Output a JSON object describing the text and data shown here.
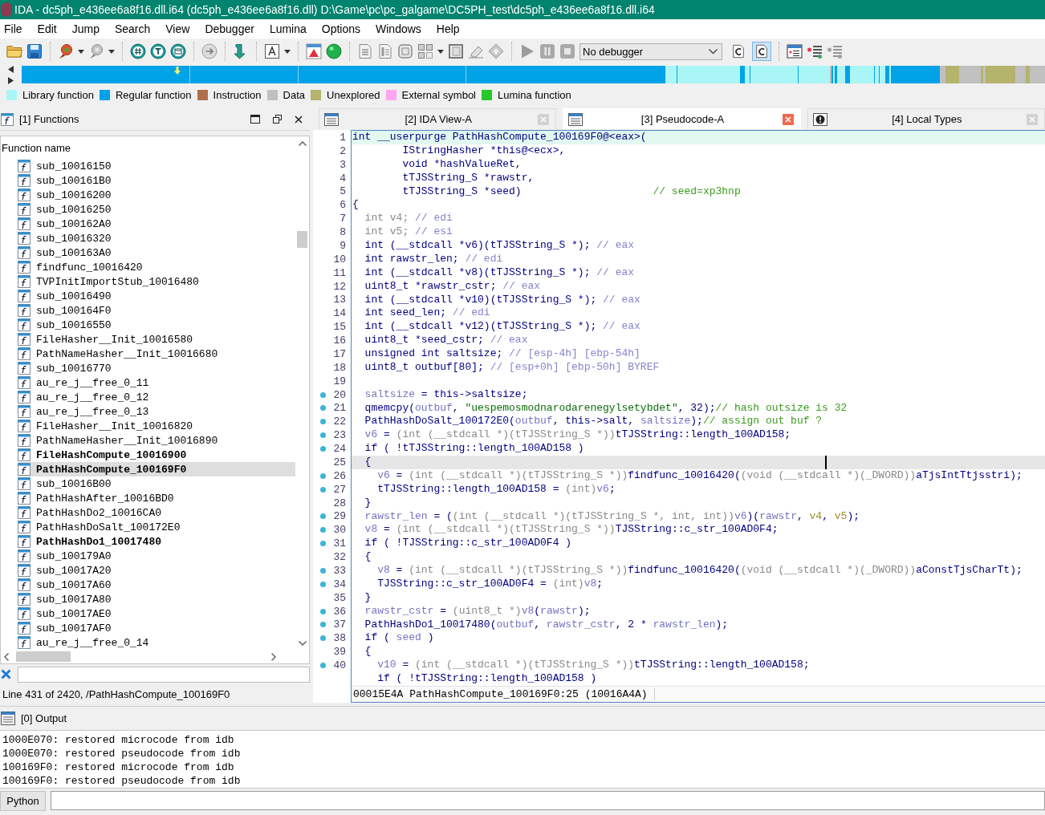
{
  "window": {
    "title": "IDA - dc5ph_e436ee6a8f16.dll.i64 (dc5ph_e436ee6a8f16.dll) D:\\Game\\pc\\pc_galgame\\DC5PH_test\\dc5ph_e436ee6a8f16.dll.i64"
  },
  "menu": [
    "File",
    "Edit",
    "Jump",
    "Search",
    "View",
    "Debugger",
    "Lumina",
    "Options",
    "Windows",
    "Help"
  ],
  "toolbar": {
    "debugger": "No debugger",
    "toggles": [
      {
        "selected": false
      },
      {
        "selected": true
      }
    ]
  },
  "legend": [
    {
      "label": "Library function",
      "color": "#aaf6f6"
    },
    {
      "label": "Regular function",
      "color": "#00a2e8"
    },
    {
      "label": "Instruction",
      "color": "#b0704c"
    },
    {
      "label": "Data",
      "color": "#c0c0c0"
    },
    {
      "label": "Unexplored",
      "color": "#b4b46c"
    },
    {
      "label": "External symbol",
      "color": "#ffa6f2"
    },
    {
      "label": "Lumina function",
      "color": "#28c828"
    }
  ],
  "functions": {
    "title": "[1] Functions",
    "column": "Function name",
    "items": [
      {
        "name": "sub_10016150",
        "bold": false,
        "selected": false
      },
      {
        "name": "sub_100161B0",
        "bold": false,
        "selected": false
      },
      {
        "name": "sub_10016200",
        "bold": false,
        "selected": false
      },
      {
        "name": "sub_10016250",
        "bold": false,
        "selected": false
      },
      {
        "name": "sub_100162A0",
        "bold": false,
        "selected": false
      },
      {
        "name": "sub_10016320",
        "bold": false,
        "selected": false
      },
      {
        "name": "sub_100163A0",
        "bold": false,
        "selected": false
      },
      {
        "name": "findfunc_10016420",
        "bold": false,
        "selected": false
      },
      {
        "name": "TVPInitImportStub_10016480",
        "bold": false,
        "selected": false
      },
      {
        "name": "sub_10016490",
        "bold": false,
        "selected": false
      },
      {
        "name": "sub_100164F0",
        "bold": false,
        "selected": false
      },
      {
        "name": "sub_10016550",
        "bold": false,
        "selected": false
      },
      {
        "name": "FileHasher__Init_10016580",
        "bold": false,
        "selected": false
      },
      {
        "name": "PathNameHasher__Init_10016680",
        "bold": false,
        "selected": false
      },
      {
        "name": "sub_10016770",
        "bold": false,
        "selected": false
      },
      {
        "name": "au_re_j__free_0_11",
        "bold": false,
        "selected": false
      },
      {
        "name": "au_re_j__free_0_12",
        "bold": false,
        "selected": false
      },
      {
        "name": "au_re_j__free_0_13",
        "bold": false,
        "selected": false
      },
      {
        "name": "FileHasher__Init_10016820",
        "bold": false,
        "selected": false
      },
      {
        "name": "PathNameHasher__Init_10016890",
        "bold": false,
        "selected": false
      },
      {
        "name": "FileHashCompute_10016900",
        "bold": true,
        "selected": false
      },
      {
        "name": "PathHashCompute_100169F0",
        "bold": true,
        "selected": true
      },
      {
        "name": "sub_10016B00",
        "bold": false,
        "selected": false
      },
      {
        "name": "PathHashAfter_10016BD0",
        "bold": false,
        "selected": false
      },
      {
        "name": "PathHashDo2_10016CA0",
        "bold": false,
        "selected": false
      },
      {
        "name": "PathHashDoSalt_100172E0",
        "bold": false,
        "selected": false
      },
      {
        "name": "PathHashDo1_10017480",
        "bold": true,
        "selected": false
      },
      {
        "name": "sub_100179A0",
        "bold": false,
        "selected": false
      },
      {
        "name": "sub_10017A20",
        "bold": false,
        "selected": false
      },
      {
        "name": "sub_10017A60",
        "bold": false,
        "selected": false
      },
      {
        "name": "sub_10017A80",
        "bold": false,
        "selected": false
      },
      {
        "name": "sub_10017AE0",
        "bold": false,
        "selected": false
      },
      {
        "name": "sub_10017AF0",
        "bold": false,
        "selected": false
      },
      {
        "name": "au_re_j__free_0_14",
        "bold": false,
        "selected": false
      }
    ],
    "status": "Line 431 of 2420, /PathHashCompute_100169F0"
  },
  "tabs": [
    {
      "label": "[2] IDA View-A",
      "kind": "listing",
      "selected": false
    },
    {
      "label": "[3] Pseudocode-A",
      "kind": "listing",
      "selected": true
    },
    {
      "label": "[4] Local Types",
      "kind": "types",
      "selected": false
    }
  ],
  "code": {
    "lines": [
      {
        "number": "1",
        "dot": false,
        "highlighted": true,
        "selected": false,
        "tokens": [
          {
            "kind": "code",
            "text": "int __userpurge PathHashCompute_100169F0@<eax>("
          }
        ]
      },
      {
        "number": "2",
        "dot": false,
        "highlighted": false,
        "selected": false,
        "tokens": [
          {
            "kind": "code",
            "text": "        IStringHasher *this@<ecx>,"
          }
        ]
      },
      {
        "number": "3",
        "dot": false,
        "highlighted": false,
        "selected": false,
        "tokens": [
          {
            "kind": "code",
            "text": "        void *hashValueRet,"
          }
        ]
      },
      {
        "number": "4",
        "dot": false,
        "highlighted": false,
        "selected": false,
        "tokens": [
          {
            "kind": "code",
            "text": "        tTJSString_S *rawstr,"
          }
        ]
      },
      {
        "number": "5",
        "dot": false,
        "highlighted": false,
        "selected": false,
        "tokens": [
          {
            "kind": "code",
            "text": "        tTJSString_S *seed)                     "
          },
          {
            "kind": "note",
            "text": "// seed=xp3hnp"
          }
        ]
      },
      {
        "number": "6",
        "dot": false,
        "highlighted": false,
        "selected": false,
        "tokens": [
          {
            "kind": "code",
            "text": "{"
          }
        ]
      },
      {
        "number": "7",
        "dot": false,
        "highlighted": false,
        "selected": false,
        "tokens": [
          {
            "kind": "cast",
            "text": "  int v4; "
          },
          {
            "kind": "comment",
            "text": "// edi"
          }
        ]
      },
      {
        "number": "8",
        "dot": false,
        "highlighted": false,
        "selected": false,
        "tokens": [
          {
            "kind": "cast",
            "text": "  int v5; "
          },
          {
            "kind": "comment",
            "text": "// esi"
          }
        ]
      },
      {
        "number": "9",
        "dot": false,
        "highlighted": false,
        "selected": false,
        "tokens": [
          {
            "kind": "code",
            "text": "  int (__stdcall *v6)(tTJSString_S *); "
          },
          {
            "kind": "comment",
            "text": "// eax"
          }
        ]
      },
      {
        "number": "10",
        "dot": false,
        "highlighted": false,
        "selected": false,
        "tokens": [
          {
            "kind": "code",
            "text": "  int rawstr_len; "
          },
          {
            "kind": "comment",
            "text": "// edi"
          }
        ]
      },
      {
        "number": "11",
        "dot": false,
        "highlighted": false,
        "selected": false,
        "tokens": [
          {
            "kind": "code",
            "text": "  int (__stdcall *v8)(tTJSString_S *); "
          },
          {
            "kind": "comment",
            "text": "// eax"
          }
        ]
      },
      {
        "number": "12",
        "dot": false,
        "highlighted": false,
        "selected": false,
        "tokens": [
          {
            "kind": "code",
            "text": "  uint8_t *rawstr_cstr; "
          },
          {
            "kind": "comment",
            "text": "// eax"
          }
        ]
      },
      {
        "number": "13",
        "dot": false,
        "highlighted": false,
        "selected": false,
        "tokens": [
          {
            "kind": "code",
            "text": "  int (__stdcall *v10)(tTJSString_S *); "
          },
          {
            "kind": "comment",
            "text": "// eax"
          }
        ]
      },
      {
        "number": "14",
        "dot": false,
        "highlighted": false,
        "selected": false,
        "tokens": [
          {
            "kind": "code",
            "text": "  int seed_len; "
          },
          {
            "kind": "comment",
            "text": "// edi"
          }
        ]
      },
      {
        "number": "15",
        "dot": false,
        "highlighted": false,
        "selected": false,
        "tokens": [
          {
            "kind": "code",
            "text": "  int (__stdcall *v12)(tTJSString_S *); "
          },
          {
            "kind": "comment",
            "text": "// eax"
          }
        ]
      },
      {
        "number": "16",
        "dot": false,
        "highlighted": false,
        "selected": false,
        "tokens": [
          {
            "kind": "code",
            "text": "  uint8_t *seed_cstr; "
          },
          {
            "kind": "comment",
            "text": "// eax"
          }
        ]
      },
      {
        "number": "17",
        "dot": false,
        "highlighted": false,
        "selected": false,
        "tokens": [
          {
            "kind": "code",
            "text": "  unsigned int saltsize; "
          },
          {
            "kind": "comment",
            "text": "// [esp-4h] [ebp-54h]"
          }
        ]
      },
      {
        "number": "18",
        "dot": false,
        "highlighted": false,
        "selected": false,
        "tokens": [
          {
            "kind": "code",
            "text": "  uint8_t outbuf[80]; "
          },
          {
            "kind": "comment",
            "text": "// [esp+0h] [ebp-50h] BYREF"
          }
        ]
      },
      {
        "number": "19",
        "dot": false,
        "highlighted": false,
        "selected": false
      },
      {
        "number": "20",
        "dot": true,
        "highlighted": false,
        "selected": false,
        "tokens": [
          {
            "kind": "local",
            "text": "  saltsize"
          },
          {
            "kind": "code",
            "text": " = this->saltsize;"
          }
        ]
      },
      {
        "number": "21",
        "dot": true,
        "highlighted": false,
        "selected": false,
        "tokens": [
          {
            "kind": "code",
            "text": "  qmemcpy("
          },
          {
            "kind": "local",
            "text": "outbuf"
          },
          {
            "kind": "code",
            "text": ", "
          },
          {
            "kind": "string",
            "text": "\"uespemosmodnarodarenegylsetybdet\""
          },
          {
            "kind": "code",
            "text": ", 32);"
          },
          {
            "kind": "note",
            "text": "// hash outsize is 32"
          }
        ]
      },
      {
        "number": "22",
        "dot": true,
        "highlighted": false,
        "selected": false,
        "tokens": [
          {
            "kind": "code",
            "text": "  PathHashDoSalt_100172E0("
          },
          {
            "kind": "local",
            "text": "outbuf"
          },
          {
            "kind": "code",
            "text": ", this->salt, "
          },
          {
            "kind": "local",
            "text": "saltsize"
          },
          {
            "kind": "code",
            "text": ");"
          },
          {
            "kind": "note",
            "text": "// assign out buf ?"
          }
        ]
      },
      {
        "number": "23",
        "dot": true,
        "highlighted": false,
        "selected": false,
        "tokens": [
          {
            "kind": "local",
            "text": "  v6"
          },
          {
            "kind": "code",
            "text": " = "
          },
          {
            "kind": "cast",
            "text": "(int (__stdcall *)(tTJSString_S *))"
          },
          {
            "kind": "code",
            "text": "tTJSString::length_100AD158;"
          }
        ]
      },
      {
        "number": "24",
        "dot": true,
        "highlighted": false,
        "selected": false,
        "tokens": [
          {
            "kind": "code",
            "text": "  if ( !tTJSString::length_100AD158 )"
          }
        ]
      },
      {
        "number": "25",
        "dot": false,
        "highlighted": false,
        "selected": true,
        "tokens": [
          {
            "kind": "code",
            "text": "  {"
          }
        ]
      },
      {
        "number": "26",
        "dot": true,
        "highlighted": false,
        "selected": false,
        "tokens": [
          {
            "kind": "local",
            "text": "    v6"
          },
          {
            "kind": "code",
            "text": " = "
          },
          {
            "kind": "cast",
            "text": "(int (__stdcall *)(tTJSString_S *))"
          },
          {
            "kind": "code",
            "text": "findfunc_10016420("
          },
          {
            "kind": "cast",
            "text": "(void (__stdcall *)(_DWORD))"
          },
          {
            "kind": "code",
            "text": "aTjsIntTtjsstri);"
          }
        ]
      },
      {
        "number": "27",
        "dot": true,
        "highlighted": false,
        "selected": false,
        "tokens": [
          {
            "kind": "code",
            "text": "    tTJSString::length_100AD158 = "
          },
          {
            "kind": "cast",
            "text": "(int)"
          },
          {
            "kind": "local",
            "text": "v6"
          },
          {
            "kind": "code",
            "text": ";"
          }
        ]
      },
      {
        "number": "28",
        "dot": false,
        "highlighted": false,
        "selected": false,
        "tokens": [
          {
            "kind": "code",
            "text": "  }"
          }
        ]
      },
      {
        "number": "29",
        "dot": true,
        "highlighted": false,
        "selected": false,
        "tokens": [
          {
            "kind": "local",
            "text": "  rawstr_len"
          },
          {
            "kind": "code",
            "text": " = ("
          },
          {
            "kind": "cast",
            "text": "(int (__stdcall *)(tTJSString_S *, int, int))"
          },
          {
            "kind": "local",
            "text": "v6"
          },
          {
            "kind": "code",
            "text": ")("
          },
          {
            "kind": "local",
            "text": "rawstr"
          },
          {
            "kind": "code",
            "text": ", "
          },
          {
            "kind": "arg",
            "text": "v4"
          },
          {
            "kind": "code",
            "text": ", "
          },
          {
            "kind": "arg",
            "text": "v5"
          },
          {
            "kind": "code",
            "text": ");"
          }
        ]
      },
      {
        "number": "30",
        "dot": true,
        "highlighted": false,
        "selected": false,
        "tokens": [
          {
            "kind": "local",
            "text": "  v8"
          },
          {
            "kind": "code",
            "text": " = "
          },
          {
            "kind": "cast",
            "text": "(int (__stdcall *)(tTJSString_S *))"
          },
          {
            "kind": "code",
            "text": "TJSString::c_str_100AD0F4;"
          }
        ]
      },
      {
        "number": "31",
        "dot": true,
        "highlighted": false,
        "selected": false,
        "tokens": [
          {
            "kind": "code",
            "text": "  if ( !TJSString::c_str_100AD0F4 )"
          }
        ]
      },
      {
        "number": "32",
        "dot": false,
        "highlighted": false,
        "selected": false,
        "tokens": [
          {
            "kind": "code",
            "text": "  {"
          }
        ]
      },
      {
        "number": "33",
        "dot": true,
        "highlighted": false,
        "selected": false,
        "tokens": [
          {
            "kind": "local",
            "text": "    v8"
          },
          {
            "kind": "code",
            "text": " = "
          },
          {
            "kind": "cast",
            "text": "(int (__stdcall *)(tTJSString_S *))"
          },
          {
            "kind": "code",
            "text": "findfunc_10016420("
          },
          {
            "kind": "cast",
            "text": "(void (__stdcall *)(_DWORD))"
          },
          {
            "kind": "code",
            "text": "aConstTjsCharTt);"
          }
        ]
      },
      {
        "number": "34",
        "dot": true,
        "highlighted": false,
        "selected": false,
        "tokens": [
          {
            "kind": "code",
            "text": "    TJSString::c_str_100AD0F4 = "
          },
          {
            "kind": "cast",
            "text": "(int)"
          },
          {
            "kind": "local",
            "text": "v8"
          },
          {
            "kind": "code",
            "text": ";"
          }
        ]
      },
      {
        "number": "35",
        "dot": false,
        "highlighted": false,
        "selected": false,
        "tokens": [
          {
            "kind": "code",
            "text": "  }"
          }
        ]
      },
      {
        "number": "36",
        "dot": true,
        "highlighted": false,
        "selected": false,
        "tokens": [
          {
            "kind": "local",
            "text": "  rawstr_cstr"
          },
          {
            "kind": "code",
            "text": " = "
          },
          {
            "kind": "cast",
            "text": "(uint8_t *)"
          },
          {
            "kind": "local",
            "text": "v8"
          },
          {
            "kind": "code",
            "text": "("
          },
          {
            "kind": "local",
            "text": "rawstr"
          },
          {
            "kind": "code",
            "text": ");"
          }
        ]
      },
      {
        "number": "37",
        "dot": true,
        "highlighted": false,
        "selected": false,
        "tokens": [
          {
            "kind": "code",
            "text": "  PathHashDo1_10017480("
          },
          {
            "kind": "local",
            "text": "outbuf"
          },
          {
            "kind": "code",
            "text": ", "
          },
          {
            "kind": "local",
            "text": "rawstr_cstr"
          },
          {
            "kind": "code",
            "text": ", 2 * "
          },
          {
            "kind": "local",
            "text": "rawstr_len"
          },
          {
            "kind": "code",
            "text": ");"
          }
        ]
      },
      {
        "number": "38",
        "dot": true,
        "highlighted": false,
        "selected": false,
        "tokens": [
          {
            "kind": "code",
            "text": "  if ( "
          },
          {
            "kind": "local",
            "text": "seed"
          },
          {
            "kind": "code",
            "text": " )"
          }
        ]
      },
      {
        "number": "39",
        "dot": false,
        "highlighted": false,
        "selected": false,
        "tokens": [
          {
            "kind": "code",
            "text": "  {"
          }
        ]
      },
      {
        "number": "40",
        "dot": true,
        "highlighted": false,
        "selected": false,
        "tokens": [
          {
            "kind": "local",
            "text": "    v10"
          },
          {
            "kind": "code",
            "text": " = "
          },
          {
            "kind": "cast",
            "text": "(int (__stdcall *)(tTJSString_S *))"
          },
          {
            "kind": "code",
            "text": "tTJSString::length_100AD158;"
          }
        ]
      },
      {
        "dot": false,
        "highlighted": false,
        "selected": false,
        "tokens": [
          {
            "kind": "code",
            "text": "    if ( !tTJSString::length_100AD158 )"
          }
        ]
      }
    ],
    "status": "00015E4A PathHashCompute_100169F0:25 (10016A4A)"
  },
  "output": {
    "title": "[0] Output",
    "lines": [
      "1000E070: restored microcode from idb",
      "1000E070: restored pseudocode from idb",
      "100169F0: restored microcode from idb",
      "100169F0: restored pseudocode from idb"
    ]
  },
  "command": {
    "language": "Python"
  }
}
